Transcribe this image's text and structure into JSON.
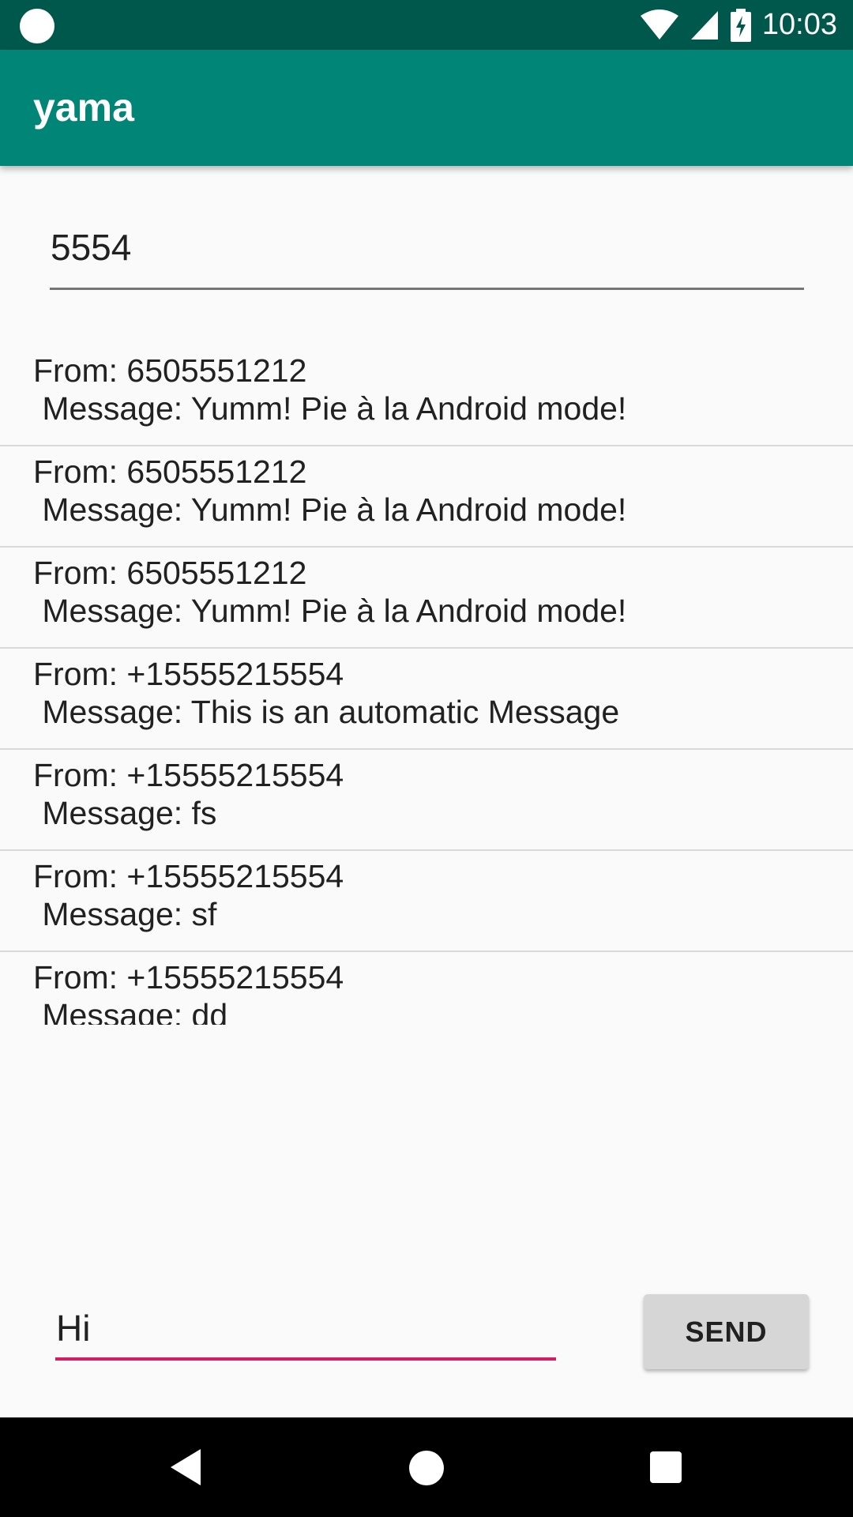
{
  "status_bar": {
    "time": "10:03"
  },
  "app_bar": {
    "title": "yama"
  },
  "number_field": {
    "value": "5554"
  },
  "messages": [
    {
      "from": "From: 6505551212",
      "text": " Message: Yumm! Pie à la Android mode!"
    },
    {
      "from": "From: 6505551212",
      "text": " Message: Yumm! Pie à la Android mode!"
    },
    {
      "from": "From: 6505551212",
      "text": " Message: Yumm! Pie à la Android mode!"
    },
    {
      "from": "From: +15555215554",
      "text": " Message: This is an automatic Message"
    },
    {
      "from": "From: +15555215554",
      "text": " Message: fs"
    },
    {
      "from": "From: +15555215554",
      "text": " Message: sf"
    },
    {
      "from": "From: +15555215554",
      "text": " Message: dd"
    }
  ],
  "compose": {
    "value": "Hi",
    "send_label": "SEND"
  },
  "colors": {
    "status_bar": "#00574b",
    "app_bar": "#008577",
    "accent": "#d81b60"
  },
  "icons": [
    "status-dot-icon",
    "wifi-icon",
    "cell-signal-icon",
    "battery-charging-icon",
    "back-icon",
    "home-icon",
    "recents-icon"
  ]
}
